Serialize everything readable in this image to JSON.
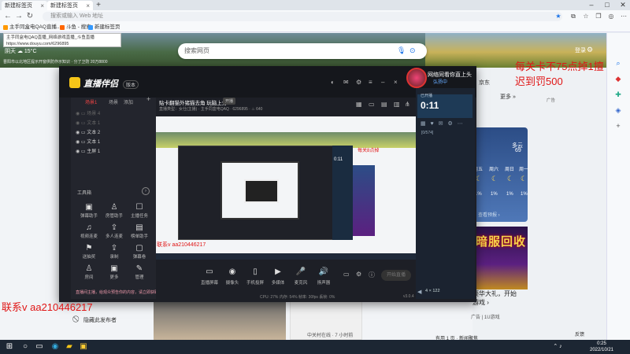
{
  "browser": {
    "tabs": [
      {
        "label": "新建标签页"
      },
      {
        "label": "新建标签页"
      }
    ],
    "new_tab": "+",
    "window_controls": [
      "–",
      "□",
      "✕"
    ],
    "address_placeholder": "搜索或输入 Web 地址",
    "favorites": [
      {
        "label": "主手同盒电QAQ直播..."
      },
      {
        "label": "斗鱼 - 搜索"
      },
      {
        "label": "新建标签页"
      }
    ],
    "tooltip": {
      "line1": "主手同盒电QAQ直播_网络游戏直播_斗鱼直播",
      "line2": "https://www.douyu.com/6296895"
    }
  },
  "newtab": {
    "search_placeholder": "搜索网页",
    "weather_chip": "阴天 ☁ 15°C",
    "weather_sub": "晋阳市以北地区提示开窗供防作示知识 · 分了卫防 20万8800",
    "sign_in": "登录",
    "ad_title": "京东",
    "more": "更多 »",
    "ad_label": "广告",
    "weather_cond": "多云",
    "weather_temp": "69",
    "forecast": [
      {
        "day": "周五",
        "pct": "1%"
      },
      {
        "day": "周六",
        "pct": "1%"
      },
      {
        "day": "周日",
        "pct": "1%"
      },
      {
        "day": "周一",
        "pct": "1%"
      }
    ],
    "forecast_link": "查看预报 ›",
    "game_ad_text": "暗服回收",
    "game_tag_line1": "豪华大礼，开始",
    "game_tag_line2": "游戏 ›",
    "game_adlabel": "广告 | 1U游戏",
    "hide_post": "隐藏此发布者",
    "news_caption": "中关村在线 · 7 小时前",
    "feedback": "反馈",
    "page_foot": "有用 1 页 · 新闻聚焦"
  },
  "overlay": {
    "red1": "每关卡不75点掉1擅",
    "red2": "迟到罚500",
    "red3": "联系v  aa210446217"
  },
  "app": {
    "logo": "直播伴侣",
    "version": "版本",
    "live_title": "网络同看你直上头",
    "live_sub": "弘扬中",
    "panel_tabs": [
      "场景1",
      "场景",
      "添加"
    ],
    "sources": [
      {
        "label": "场景 4",
        "dim": true
      },
      {
        "label": "文本 1",
        "dim": true
      },
      {
        "label": "文本 2",
        "dim": false
      },
      {
        "label": "文本 1",
        "dim": false
      },
      {
        "label": "主屏 1",
        "dim": false
      }
    ],
    "tools_title": "工具箱",
    "tools": [
      {
        "icon": "▣",
        "label": "弹幕助手"
      },
      {
        "icon": "♙",
        "label": "房管助手"
      },
      {
        "icon": "☐",
        "label": "主播任务"
      },
      {
        "icon": "♫",
        "label": "视频连麦"
      },
      {
        "icon": "⇪",
        "label": "多人连麦"
      },
      {
        "icon": "▤",
        "label": "榜单助手"
      },
      {
        "icon": "⚑",
        "label": "送抽奖"
      },
      {
        "icon": "⇪",
        "label": "录制"
      },
      {
        "icon": "▢",
        "label": "弹幕卷"
      },
      {
        "icon": "♙",
        "label": "房间"
      },
      {
        "icon": "▣",
        "label": "更多"
      },
      {
        "icon": "✎",
        "label": "管理"
      }
    ],
    "notice": "直播间主播，给观众预告你的内容，请立即获取节奏按钮",
    "stream_title": "贴卡翻猫外猪猫去角 玩脑上分",
    "stream_status": "开播",
    "stream_meta": "直播类型：女仕(主播)  ·  主手同盒电QAQ  ·  6296895  ·  ♨ 640",
    "preview_time": "0:11",
    "preview_red": "每关8点掉",
    "preview_redtext": "联系v  aa210446217",
    "controls": [
      {
        "icon": "▭",
        "label": "直播屏幕"
      },
      {
        "icon": "◉",
        "label": "摄像头"
      },
      {
        "icon": "▯",
        "label": "手机投屏"
      },
      {
        "icon": "▶",
        "label": "多媒体"
      },
      {
        "icon": "🎤",
        "label": "麦克风"
      },
      {
        "icon": "🔊",
        "label": "扬声器"
      }
    ],
    "go_live": "开始直播",
    "status_line": "CPU: 27%    内存: 54%    帧率: 30fps    丢帧: 0%",
    "status_right": "v3.0.4",
    "timer_label": "已开播",
    "timer": "0:11",
    "viewer_count": "[0/574]",
    "viewer_foot": "4 × 122"
  },
  "taskbar": {
    "time": "0:25",
    "date": "2022/10/21"
  },
  "colors": {
    "overlay_red": "#e01616",
    "app_bg": "#1d1f26",
    "taskbar": "#1c2633"
  }
}
